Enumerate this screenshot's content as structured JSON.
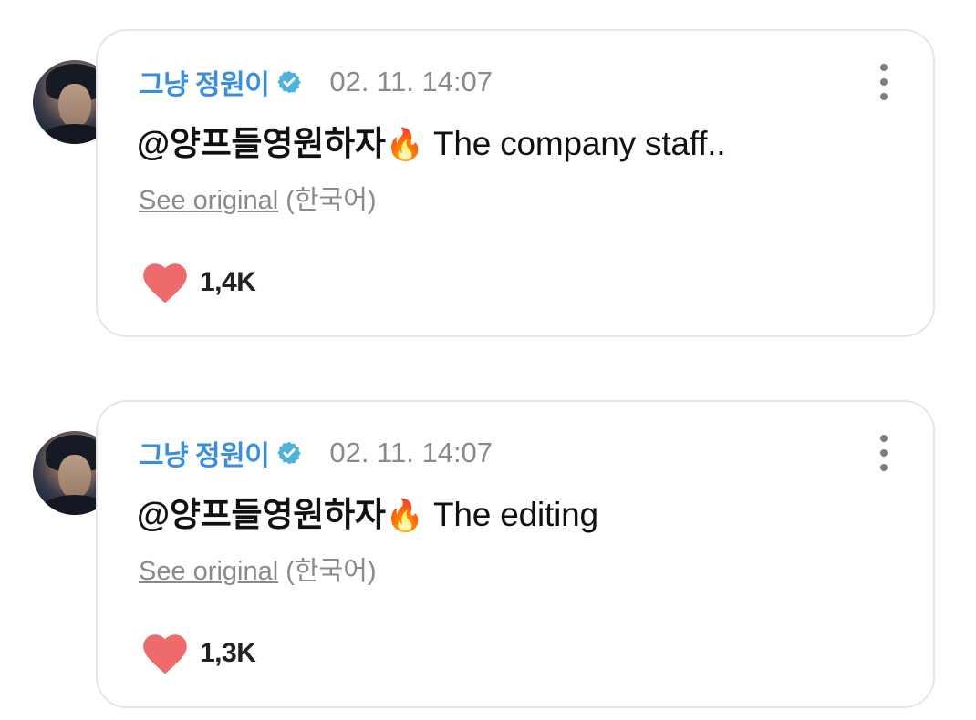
{
  "colors": {
    "username": "#3a8ee0",
    "verified_badge": "#4fb3d9",
    "timestamp": "#8a8a8a",
    "heart": "#ef6b6b",
    "border": "#e6e6e6"
  },
  "comments": [
    {
      "username": "그냥 정원이",
      "verified": true,
      "timestamp": "02. 11. 14:07",
      "mention": "@양프들영원하자",
      "emoji": "🔥",
      "text": "The company staff..",
      "see_original_label": "See original",
      "language_label": "(한국어)",
      "likes": "1,4K"
    },
    {
      "username": "그냥 정원이",
      "verified": true,
      "timestamp": "02. 11. 14:07",
      "mention": "@양프들영원하자",
      "emoji": "🔥",
      "text": "The editing",
      "see_original_label": "See original",
      "language_label": "(한국어)",
      "likes": "1,3K"
    }
  ]
}
